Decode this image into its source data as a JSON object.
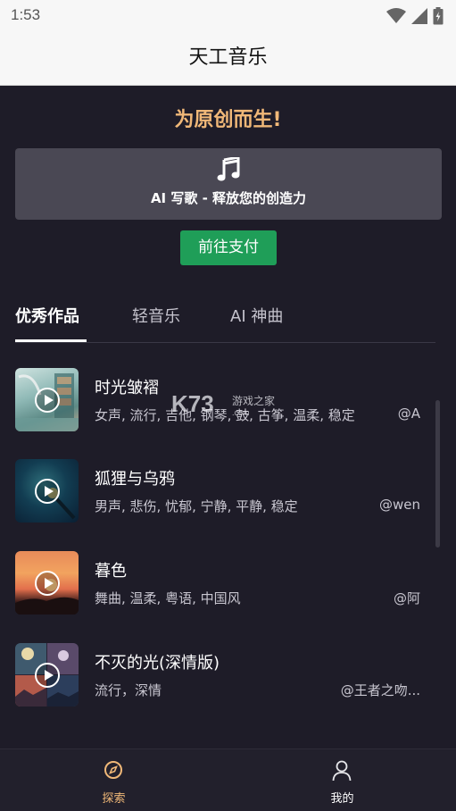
{
  "status_bar": {
    "time": "1:53",
    "icons": [
      "wifi-icon",
      "cell-signal-icon",
      "battery-icon"
    ]
  },
  "app_bar": {
    "title": "天工音乐"
  },
  "hero": {
    "slogan": "为原创而生!",
    "ai_card_icon": "music-note-icon",
    "ai_card_label": "AI 写歌 - 释放您的创造力",
    "pay_button": "前往支付"
  },
  "tabs": [
    {
      "label": "优秀作品",
      "active": true
    },
    {
      "label": "轻音乐",
      "active": false
    },
    {
      "label": "AI 神曲",
      "active": false
    }
  ],
  "songs": [
    {
      "title": "时光皱褶",
      "tags": "女声, 流行, 吉他, 钢琴, 鼓, 古筝, 温柔, 稳定",
      "author": "@A"
    },
    {
      "title": "狐狸与乌鸦",
      "tags": "男声, 悲伤, 忧郁, 宁静, 平静, 稳定",
      "author": "@wen"
    },
    {
      "title": "暮色",
      "tags": "舞曲, 温柔, 粤语, 中国风",
      "author": "@阿"
    },
    {
      "title": "不灭的光(深情版)",
      "tags": "流行，深情",
      "author": "@王者之吻..."
    }
  ],
  "watermark": {
    "big": "K73",
    "small": "游戏之家",
    "url": ".com"
  },
  "bottom_nav": [
    {
      "label": "探索",
      "icon": "compass-icon",
      "active": true
    },
    {
      "label": "我的",
      "icon": "user-icon",
      "active": false
    }
  ],
  "colors": {
    "background": "#1e1c28",
    "slogan": "#f0b878",
    "pay_button": "#1f9e58",
    "nav_active": "#f0b878"
  }
}
